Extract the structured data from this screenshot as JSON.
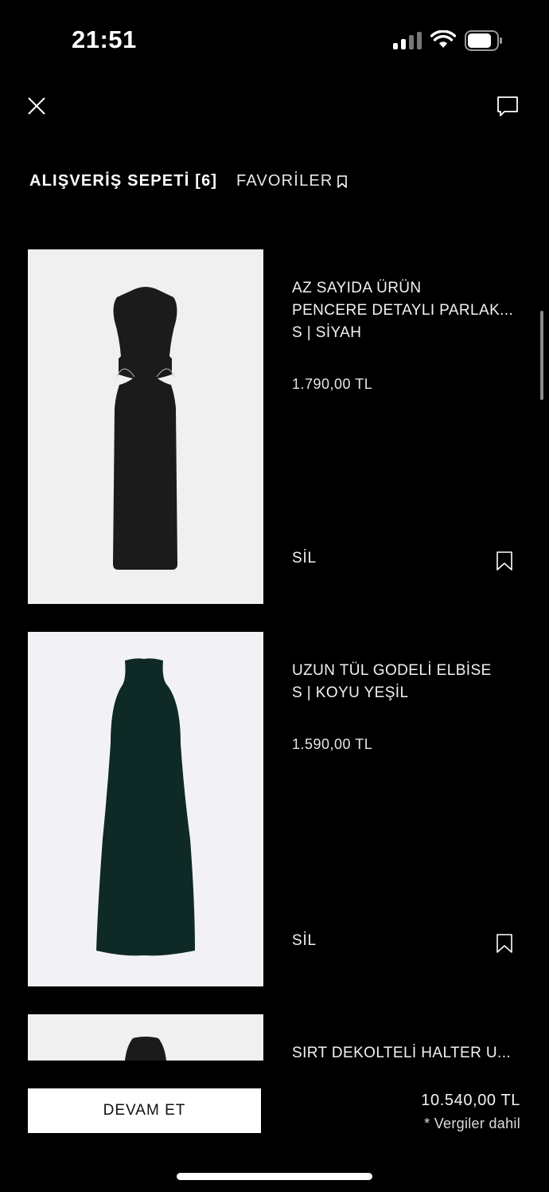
{
  "status_bar": {
    "time": "21:51"
  },
  "tabs": {
    "cart_label": "ALIŞVERİŞ SEPETİ [6]",
    "favorites_label": "FAVORİLER"
  },
  "items": [
    {
      "badge": "AZ SAYIDA ÜRÜN",
      "name": "PENCERE DETAYLI PARLAK...",
      "variant": "S | SİYAH",
      "price": "1.790,00 TL",
      "remove_label": "SİL",
      "dress_color": "#1b1b1b"
    },
    {
      "name": "UZUN TÜL GODELİ ELBİSE",
      "variant": "S | KOYU YEŞİL",
      "price": "1.590,00 TL",
      "remove_label": "SİL",
      "dress_color": "#0f2a26"
    },
    {
      "name": "SIRT DEKOLTELİ HALTER U...",
      "dress_color": "#1b1b1b"
    }
  ],
  "checkout": {
    "button_label": "DEVAM ET",
    "total": "10.540,00 TL",
    "tax_note": "* Vergiler dahil"
  },
  "colors": {
    "background": "#000000",
    "text": "#ffffff",
    "image_bg": "#f0f0f0"
  },
  "icons": [
    "close-icon",
    "chat-icon",
    "bookmark-icon",
    "signal-icon",
    "wifi-icon",
    "battery-icon"
  ]
}
